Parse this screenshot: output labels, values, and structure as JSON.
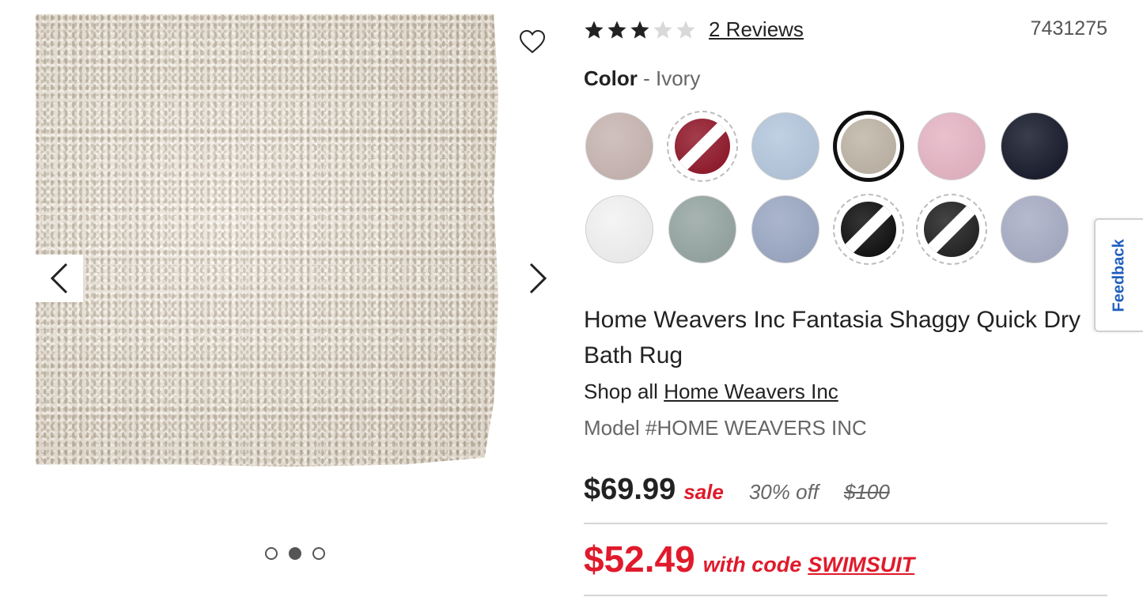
{
  "gallery": {
    "image_alt": "Home Weavers Inc Fantasia Shaggy Quick Dry Bath Rug",
    "prev_icon": "chevron-left-icon",
    "next_icon": "chevron-right-icon",
    "favorite_icon": "heart-icon",
    "dots": [
      {
        "active": false
      },
      {
        "active": true
      },
      {
        "active": false
      }
    ]
  },
  "product": {
    "rating": 3,
    "rating_max": 5,
    "reviews_label": "2 Reviews",
    "sku": "7431275",
    "color_label": "Color",
    "color_sep": " - ",
    "color_value": "Ivory",
    "swatches": [
      {
        "color": "#c7b4b0",
        "state": "available"
      },
      {
        "color": "#8e1224",
        "state": "unavailable"
      },
      {
        "color": "#b3c6dd",
        "state": "available"
      },
      {
        "color": "#bdb3a4",
        "state": "selected"
      },
      {
        "color": "#e6b3c3",
        "state": "available"
      },
      {
        "color": "#0f1324",
        "state": "available"
      },
      {
        "color": "#f2f2f2",
        "state": "available"
      },
      {
        "color": "#93a3a0",
        "state": "available"
      },
      {
        "color": "#99a6c3",
        "state": "available"
      },
      {
        "color": "#080808",
        "state": "unavailable"
      },
      {
        "color": "#1b1b1b",
        "state": "unavailable"
      },
      {
        "color": "#a5abc4",
        "state": "available"
      }
    ],
    "title": "Home Weavers Inc Fantasia Shaggy Quick Dry Bath Rug",
    "shop_all_prefix": "Shop all ",
    "brand": "Home Weavers Inc",
    "model": "Model #HOME WEAVERS INC",
    "price": "$69.99",
    "sale_label": "sale",
    "discount": "30% off",
    "original_price": "$100",
    "promo_price": "$52.49",
    "promo_text": "with code",
    "promo_code": "SWIMSUIT"
  },
  "feedback": {
    "label": "Feedback"
  },
  "colors": {
    "accent_red": "#e01a2b",
    "link_blue": "#1f5fbf"
  }
}
